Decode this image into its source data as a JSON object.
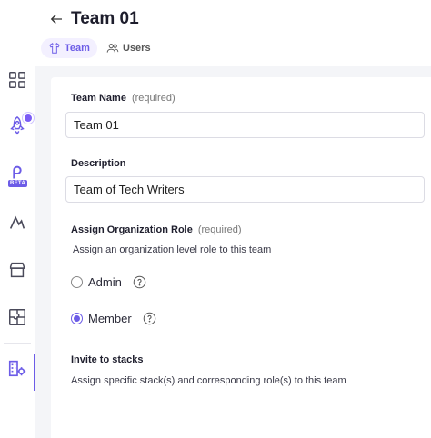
{
  "header": {
    "title": "Team 01",
    "tabs": [
      {
        "label": "Team",
        "active": true
      },
      {
        "label": "Users",
        "active": false
      }
    ]
  },
  "sidebar": {
    "items": [
      {
        "icon": "grid-icon"
      },
      {
        "icon": "rocket-icon",
        "has_notification": true
      },
      {
        "icon": "automation-icon",
        "badge": "BETA"
      },
      {
        "icon": "launch-icon"
      },
      {
        "icon": "store-icon"
      },
      {
        "icon": "puzzle-icon"
      },
      {
        "icon": "org-settings-icon",
        "active": true
      }
    ]
  },
  "form": {
    "team_name_label": "Team Name",
    "team_name_required": "(required)",
    "team_name_value": "Team 01",
    "description_label": "Description",
    "description_value": "Team of Tech Writers",
    "role_label": "Assign Organization Role",
    "role_required": "(required)",
    "role_help": "Assign an organization level role to this team",
    "roles": [
      {
        "label": "Admin",
        "selected": false
      },
      {
        "label": "Member",
        "selected": true
      }
    ],
    "stacks_label": "Invite to stacks",
    "stacks_help": "Assign specific stack(s) and corresponding role(s) to this team"
  },
  "colors": {
    "accent": "#6c5ce7",
    "tab_active_bg": "#f3f0ff",
    "background": "#f4f5f8"
  }
}
